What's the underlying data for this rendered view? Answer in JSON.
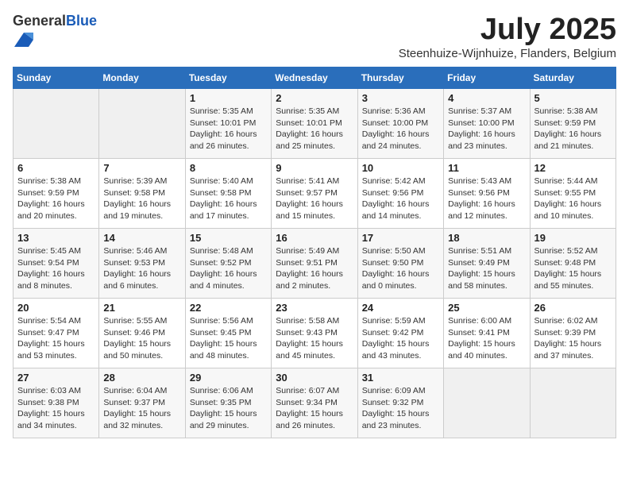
{
  "logo": {
    "general": "General",
    "blue": "Blue"
  },
  "title": "July 2025",
  "subtitle": "Steenhuize-Wijnhuize, Flanders, Belgium",
  "days_of_week": [
    "Sunday",
    "Monday",
    "Tuesday",
    "Wednesday",
    "Thursday",
    "Friday",
    "Saturday"
  ],
  "weeks": [
    [
      {
        "day": "",
        "info": ""
      },
      {
        "day": "",
        "info": ""
      },
      {
        "day": "1",
        "info": "Sunrise: 5:35 AM\nSunset: 10:01 PM\nDaylight: 16 hours and 26 minutes."
      },
      {
        "day": "2",
        "info": "Sunrise: 5:35 AM\nSunset: 10:01 PM\nDaylight: 16 hours and 25 minutes."
      },
      {
        "day": "3",
        "info": "Sunrise: 5:36 AM\nSunset: 10:00 PM\nDaylight: 16 hours and 24 minutes."
      },
      {
        "day": "4",
        "info": "Sunrise: 5:37 AM\nSunset: 10:00 PM\nDaylight: 16 hours and 23 minutes."
      },
      {
        "day": "5",
        "info": "Sunrise: 5:38 AM\nSunset: 9:59 PM\nDaylight: 16 hours and 21 minutes."
      }
    ],
    [
      {
        "day": "6",
        "info": "Sunrise: 5:38 AM\nSunset: 9:59 PM\nDaylight: 16 hours and 20 minutes."
      },
      {
        "day": "7",
        "info": "Sunrise: 5:39 AM\nSunset: 9:58 PM\nDaylight: 16 hours and 19 minutes."
      },
      {
        "day": "8",
        "info": "Sunrise: 5:40 AM\nSunset: 9:58 PM\nDaylight: 16 hours and 17 minutes."
      },
      {
        "day": "9",
        "info": "Sunrise: 5:41 AM\nSunset: 9:57 PM\nDaylight: 16 hours and 15 minutes."
      },
      {
        "day": "10",
        "info": "Sunrise: 5:42 AM\nSunset: 9:56 PM\nDaylight: 16 hours and 14 minutes."
      },
      {
        "day": "11",
        "info": "Sunrise: 5:43 AM\nSunset: 9:56 PM\nDaylight: 16 hours and 12 minutes."
      },
      {
        "day": "12",
        "info": "Sunrise: 5:44 AM\nSunset: 9:55 PM\nDaylight: 16 hours and 10 minutes."
      }
    ],
    [
      {
        "day": "13",
        "info": "Sunrise: 5:45 AM\nSunset: 9:54 PM\nDaylight: 16 hours and 8 minutes."
      },
      {
        "day": "14",
        "info": "Sunrise: 5:46 AM\nSunset: 9:53 PM\nDaylight: 16 hours and 6 minutes."
      },
      {
        "day": "15",
        "info": "Sunrise: 5:48 AM\nSunset: 9:52 PM\nDaylight: 16 hours and 4 minutes."
      },
      {
        "day": "16",
        "info": "Sunrise: 5:49 AM\nSunset: 9:51 PM\nDaylight: 16 hours and 2 minutes."
      },
      {
        "day": "17",
        "info": "Sunrise: 5:50 AM\nSunset: 9:50 PM\nDaylight: 16 hours and 0 minutes."
      },
      {
        "day": "18",
        "info": "Sunrise: 5:51 AM\nSunset: 9:49 PM\nDaylight: 15 hours and 58 minutes."
      },
      {
        "day": "19",
        "info": "Sunrise: 5:52 AM\nSunset: 9:48 PM\nDaylight: 15 hours and 55 minutes."
      }
    ],
    [
      {
        "day": "20",
        "info": "Sunrise: 5:54 AM\nSunset: 9:47 PM\nDaylight: 15 hours and 53 minutes."
      },
      {
        "day": "21",
        "info": "Sunrise: 5:55 AM\nSunset: 9:46 PM\nDaylight: 15 hours and 50 minutes."
      },
      {
        "day": "22",
        "info": "Sunrise: 5:56 AM\nSunset: 9:45 PM\nDaylight: 15 hours and 48 minutes."
      },
      {
        "day": "23",
        "info": "Sunrise: 5:58 AM\nSunset: 9:43 PM\nDaylight: 15 hours and 45 minutes."
      },
      {
        "day": "24",
        "info": "Sunrise: 5:59 AM\nSunset: 9:42 PM\nDaylight: 15 hours and 43 minutes."
      },
      {
        "day": "25",
        "info": "Sunrise: 6:00 AM\nSunset: 9:41 PM\nDaylight: 15 hours and 40 minutes."
      },
      {
        "day": "26",
        "info": "Sunrise: 6:02 AM\nSunset: 9:39 PM\nDaylight: 15 hours and 37 minutes."
      }
    ],
    [
      {
        "day": "27",
        "info": "Sunrise: 6:03 AM\nSunset: 9:38 PM\nDaylight: 15 hours and 34 minutes."
      },
      {
        "day": "28",
        "info": "Sunrise: 6:04 AM\nSunset: 9:37 PM\nDaylight: 15 hours and 32 minutes."
      },
      {
        "day": "29",
        "info": "Sunrise: 6:06 AM\nSunset: 9:35 PM\nDaylight: 15 hours and 29 minutes."
      },
      {
        "day": "30",
        "info": "Sunrise: 6:07 AM\nSunset: 9:34 PM\nDaylight: 15 hours and 26 minutes."
      },
      {
        "day": "31",
        "info": "Sunrise: 6:09 AM\nSunset: 9:32 PM\nDaylight: 15 hours and 23 minutes."
      },
      {
        "day": "",
        "info": ""
      },
      {
        "day": "",
        "info": ""
      }
    ]
  ]
}
